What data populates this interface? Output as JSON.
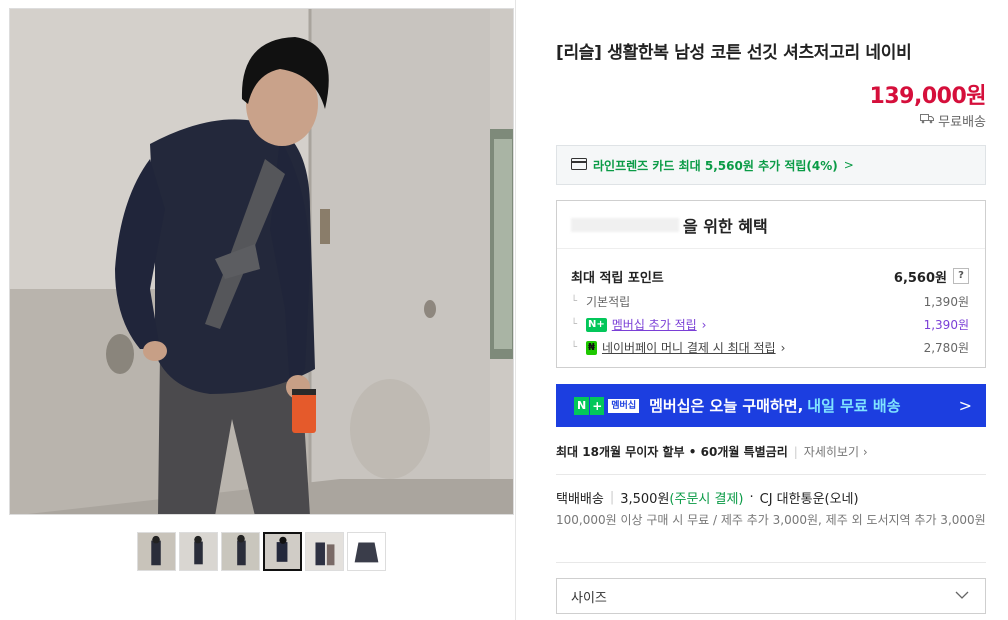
{
  "product": {
    "title": "[리슬] 생활한복 남성 코튼 선깃 셔츠저고리 네이비",
    "price": "139,000원",
    "shipping_free": "무료배송"
  },
  "gallery": {
    "main_alt": "product-photo",
    "thumbnail_count": 6,
    "active_thumbnail": 4
  },
  "card_benefit": {
    "text": "라인프렌즈 카드 최대 5,560원 추가 적립(4%)",
    "chevron": ">"
  },
  "benefits": {
    "title_suffix": "을 위한 혜택",
    "max_points_label": "최대 적립 포인트",
    "max_points_value": "6,560원",
    "help": "?",
    "rows": [
      {
        "label": "기본적립",
        "value": "1,390원"
      },
      {
        "label": "멤버십 추가 적립",
        "value": "1,390원"
      },
      {
        "label": "네이버페이 머니 결제 시 최대 적립",
        "value": "2,780원"
      }
    ]
  },
  "banner": {
    "badge_n": "N",
    "badge_plus": "+",
    "badge_mem": "멤버십",
    "text": "멤버십은 오늘 구매하면,",
    "highlight": "내일 무료 배송",
    "chevron": ">"
  },
  "installment": {
    "text": "최대 18개월 무이자 할부 • 60개월 특별금리",
    "more": "자세히보기"
  },
  "delivery": {
    "type": "택배배송",
    "fee": "3,500원",
    "fee_note": "(주문시 결제)",
    "carrier": "CJ 대한통운(오네)",
    "note": "100,000원 이상 구매 시 무료 / 제주 추가 3,000원, 제주 외 도서지역 추가 3,000원"
  },
  "options": {
    "size_placeholder": "사이즈"
  },
  "colors": {
    "price": "#d50f3b",
    "naver_green": "#03c75a",
    "banner_blue": "#1c3ee0",
    "membership_purple": "#7a3fd6"
  }
}
